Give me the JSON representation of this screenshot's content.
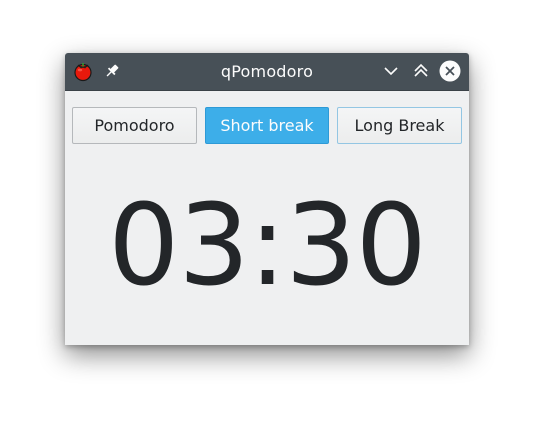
{
  "window": {
    "title": "qPomodoro",
    "icons": {
      "app": "tomato-icon",
      "pin": "pin-icon",
      "minimize": "chevron-down-icon",
      "maximize": "double-chevron-up-icon",
      "close": "close-icon"
    }
  },
  "mode_buttons": [
    {
      "label": "Pomodoro",
      "active": false
    },
    {
      "label": "Short break",
      "active": true
    },
    {
      "label": "Long Break",
      "active": false
    }
  ],
  "timer": {
    "display": "03:30"
  },
  "colors": {
    "titlebar": "#475057",
    "accent": "#3daee9",
    "background": "#eff0f1",
    "text": "#232629"
  }
}
